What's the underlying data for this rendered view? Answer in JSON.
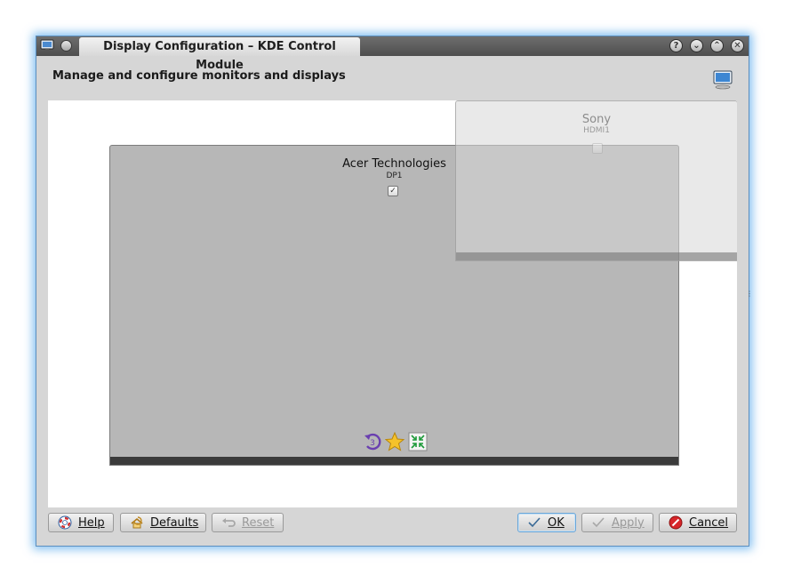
{
  "window": {
    "title": "Display Configuration – KDE Control Module",
    "controls": [
      "help-icon",
      "minimize-icon",
      "maximize-icon",
      "close-icon"
    ]
  },
  "header": {
    "title": "Manage and configure monitors and displays",
    "icon": "monitor-icon"
  },
  "monitors": [
    {
      "name": "Acer Technologies",
      "output": "DP1",
      "enabled": true
    },
    {
      "name": "Sony",
      "output": "HDMI1",
      "enabled": false
    }
  ],
  "monitor_tools": [
    "rotate-icon",
    "primary-star-icon",
    "resize-icon"
  ],
  "buttons": {
    "help": "Help",
    "defaults": "Defaults",
    "reset": "Reset",
    "ok": "OK",
    "apply": "Apply",
    "cancel": "Cancel"
  },
  "colors": {
    "accent": "#5aa8e8",
    "primary_monitor": "#b7b7b7",
    "info_blue": "#1b5fb5"
  }
}
